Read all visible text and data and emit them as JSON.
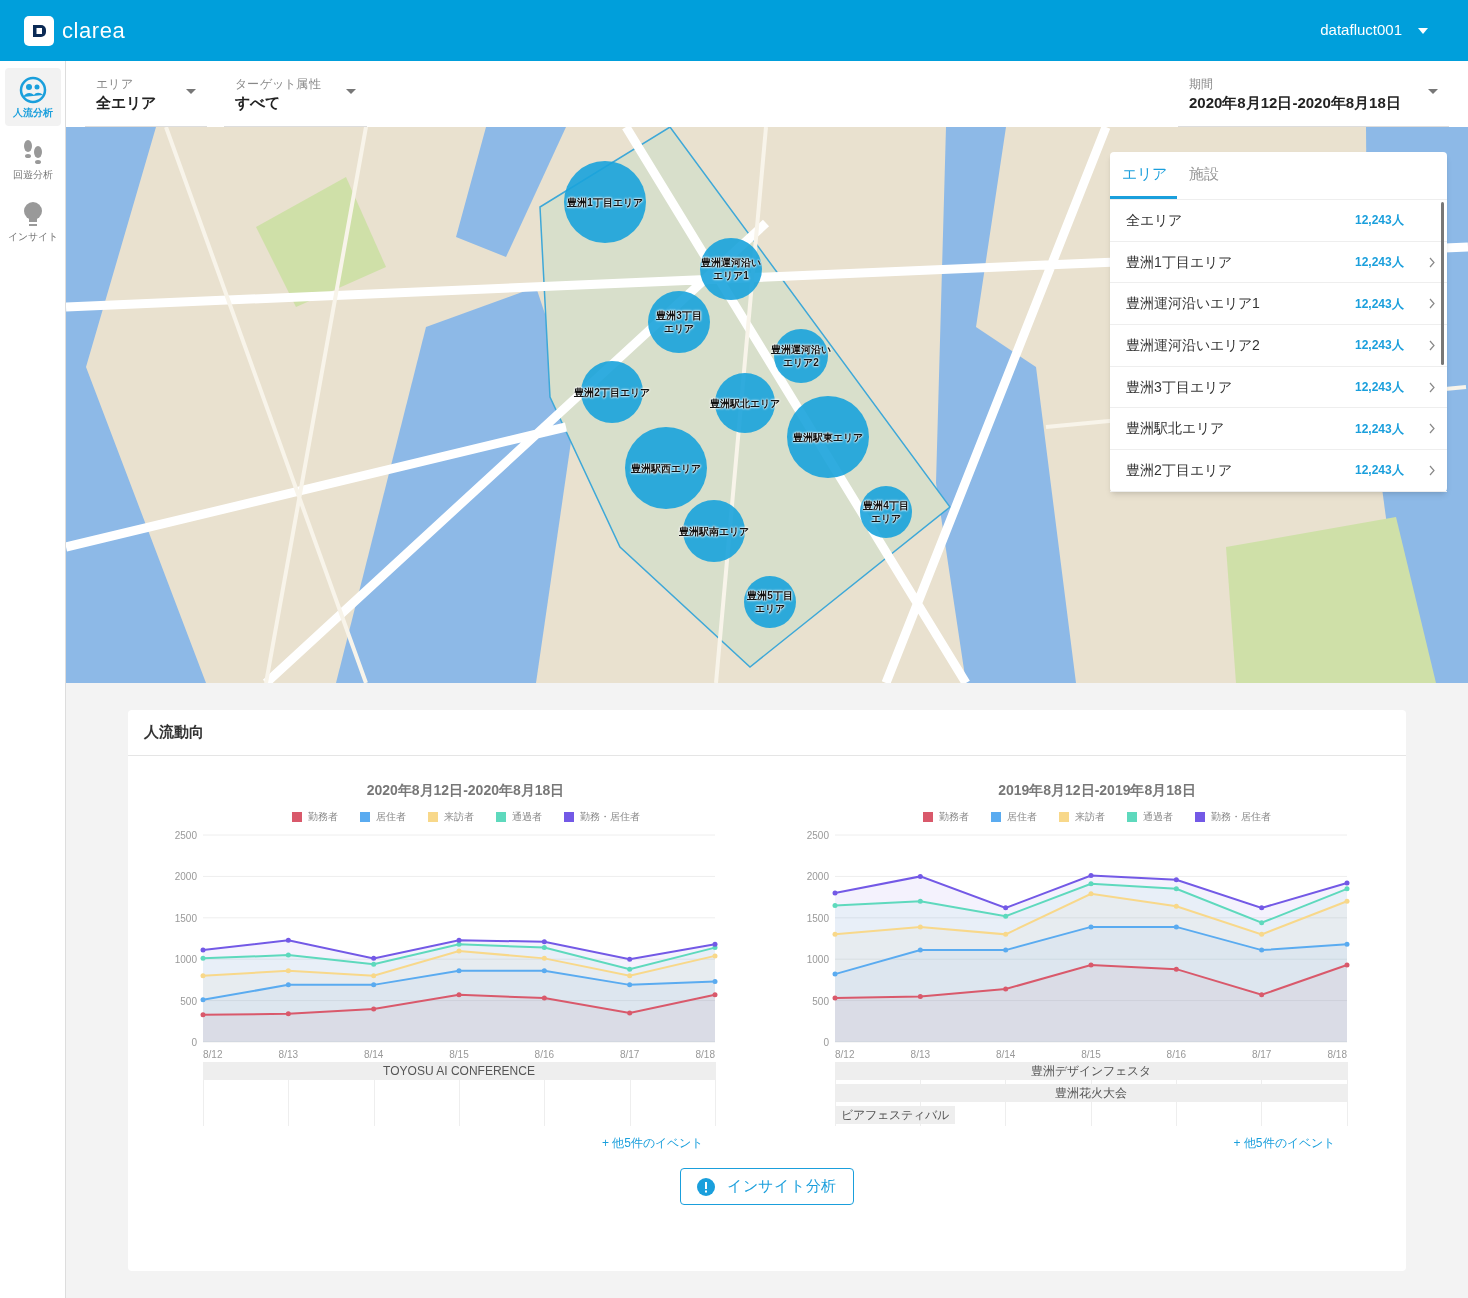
{
  "header": {
    "logo": "clarea",
    "user": "datafluct001"
  },
  "sidebar": {
    "items": [
      {
        "label": "人流分析",
        "selected": true
      },
      {
        "label": "回遊分析",
        "selected": false
      },
      {
        "label": "インサイト",
        "selected": false
      }
    ]
  },
  "filters": [
    {
      "label": "エリア",
      "value": "全エリア"
    },
    {
      "label": "ターゲット属性",
      "value": "すべて"
    },
    {
      "label": "期間",
      "value": "2020年8月12日-2020年8月18日"
    }
  ],
  "map": {
    "areas": [
      {
        "label": "豊洲1丁目エリア"
      },
      {
        "label": "豊洲運河沿いエリア1"
      },
      {
        "label": "豊洲3丁目エリア"
      },
      {
        "label": "豊洲運河沿いエリア2"
      },
      {
        "label": "豊洲2丁目エリア"
      },
      {
        "label": "豊洲駅北エリア"
      },
      {
        "label": "豊洲駅東エリア"
      },
      {
        "label": "豊洲駅西エリア"
      },
      {
        "label": "豊洲駅南エリア"
      },
      {
        "label": "豊洲4丁目エリア"
      },
      {
        "label": "豊洲5丁目エリア"
      }
    ]
  },
  "area_panel": {
    "tabs": [
      {
        "label": "エリア",
        "selected": true
      },
      {
        "label": "施設",
        "selected": false
      }
    ],
    "rows": [
      {
        "name": "全エリア",
        "count": "12,243人",
        "expandable": false
      },
      {
        "name": "豊洲1丁目エリア",
        "count": "12,243人",
        "expandable": true
      },
      {
        "name": "豊洲運河沿いエリア1",
        "count": "12,243人",
        "expandable": true
      },
      {
        "name": "豊洲運河沿いエリア2",
        "count": "12,243人",
        "expandable": true
      },
      {
        "name": "豊洲3丁目エリア",
        "count": "12,243人",
        "expandable": true
      },
      {
        "name": "豊洲駅北エリア",
        "count": "12,243人",
        "expandable": true
      },
      {
        "name": "豊洲2丁目エリア",
        "count": "12,243人",
        "expandable": true
      }
    ]
  },
  "trend": {
    "title": "人流動向",
    "charts": [
      {
        "chart_data": {
          "type": "area",
          "title": "2020年8月12日-2020年8月18日",
          "categories": [
            "8/12",
            "8/13",
            "8/14",
            "8/15",
            "8/16",
            "8/17",
            "8/18"
          ],
          "ylim": [
            0,
            2500
          ],
          "yticks": [
            0,
            500,
            1000,
            1500,
            2000,
            2500
          ],
          "stacked": false,
          "grid": true,
          "series": [
            {
              "name": "勤務者",
              "color": "#d9596b",
              "values": [
                330,
                340,
                400,
                570,
                530,
                350,
                570
              ]
            },
            {
              "name": "居住者",
              "color": "#5aabf0",
              "values": [
                510,
                690,
                690,
                860,
                860,
                690,
                730
              ]
            },
            {
              "name": "来訪者",
              "color": "#f8d88a",
              "values": [
                800,
                860,
                800,
                1100,
                1010,
                800,
                1040
              ]
            },
            {
              "name": "通過者",
              "color": "#5ed9bd",
              "values": [
                1010,
                1050,
                940,
                1180,
                1140,
                880,
                1140
              ]
            },
            {
              "name": "勤務・居住者",
              "color": "#7359e6",
              "values": [
                1110,
                1230,
                1010,
                1230,
                1210,
                1000,
                1180
              ]
            }
          ]
        },
        "events": [
          {
            "label": "TOYOSU AI CONFERENCE",
            "kind": "full"
          }
        ],
        "more_link": "+ 他5件のイベント"
      },
      {
        "chart_data": {
          "type": "area",
          "title": "2019年8月12日-2019年8月18日",
          "categories": [
            "8/12",
            "8/13",
            "8/14",
            "8/15",
            "8/16",
            "8/17",
            "8/18"
          ],
          "ylim": [
            0,
            2500
          ],
          "yticks": [
            0,
            500,
            1000,
            1500,
            2000,
            2500
          ],
          "stacked": false,
          "grid": true,
          "series": [
            {
              "name": "勤務者",
              "color": "#d9596b",
              "values": [
                530,
                550,
                640,
                930,
                880,
                570,
                930
              ]
            },
            {
              "name": "居住者",
              "color": "#5aabf0",
              "values": [
                820,
                1110,
                1110,
                1390,
                1390,
                1110,
                1180
              ]
            },
            {
              "name": "来訪者",
              "color": "#f8d88a",
              "values": [
                1300,
                1390,
                1300,
                1790,
                1640,
                1300,
                1700
              ]
            },
            {
              "name": "通過者",
              "color": "#5ed9bd",
              "values": [
                1650,
                1700,
                1520,
                1910,
                1850,
                1440,
                1850
              ]
            },
            {
              "name": "勤務・居住者",
              "color": "#7359e6",
              "values": [
                1800,
                2000,
                1620,
                2010,
                1960,
                1620,
                1920
              ]
            }
          ]
        },
        "events": [
          {
            "label": "豊洲デザインフェスタ",
            "kind": "full"
          },
          {
            "label": "豊洲花火大会",
            "kind": "full"
          },
          {
            "label": "ビアフェスティバル",
            "kind": "short"
          }
        ],
        "more_link": "+ 他5件のイベント"
      }
    ],
    "insight_button": "インサイト分析"
  }
}
